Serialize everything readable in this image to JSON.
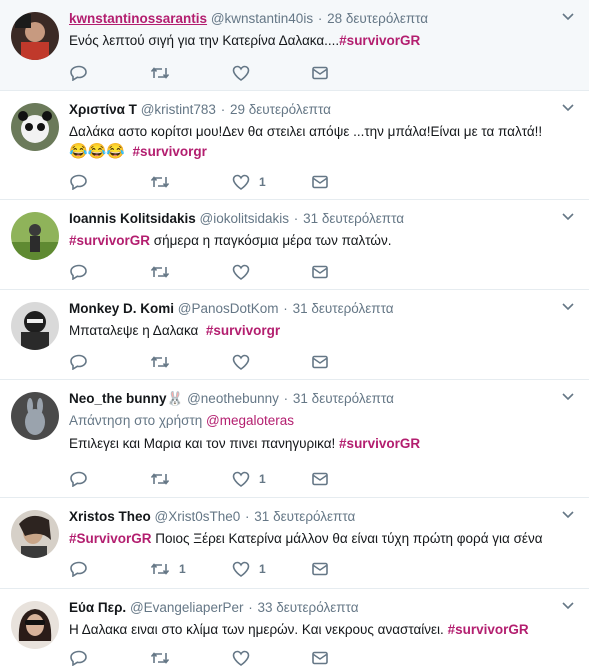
{
  "colors": {
    "accent": "#b31e6f",
    "muted": "#657786",
    "border": "#e6ecf0",
    "highlight_bg": "#f5f8fa"
  },
  "tweets": [
    {
      "name": "kwnstantinossarantis",
      "handle": "@kwnstantin40is",
      "time": "28 δευτερόλεπτα",
      "text": "Ενός λεπτού σιγή για την Κατερίνα Δαλακα....",
      "hashtag": "#survivorGR",
      "retweets": "",
      "likes": ""
    },
    {
      "name": "Χριστίνα Τ",
      "handle": "@kristint783",
      "time": "29 δευτερόλεπτα",
      "text": "Δαλάκα αστο κορίτσι μου!Δεν θα στειλει απόψε ...την μπάλα!Είναι με τα παλτά!!",
      "emoji": "😂😂😂",
      "hashtag": "#survivorgr",
      "retweets": "",
      "likes": "1"
    },
    {
      "name": "Ioannis Kolitsidakis",
      "handle": "@iokolitsidakis",
      "time": "31 δευτερόλεπτα",
      "hashtag": "#survivorGR",
      "text": " σήμερα η παγκόσμια μέρα των παλτών.",
      "retweets": "",
      "likes": ""
    },
    {
      "name": "Monkey D. Komi",
      "handle": "@PanosDotKom",
      "time": "31 δευτερόλεπτα",
      "text": "Μπαταλεψε η Δαλακα ",
      "hashtag": "#survivorgr",
      "retweets": "",
      "likes": ""
    },
    {
      "name": "Neo_the bunny",
      "name_emoji": "🐰",
      "handle": "@neothebunny",
      "time": "31 δευτερόλεπτα",
      "reply_prefix": "Απάντηση στο χρήστη ",
      "reply_mention": "@megaloteras",
      "text": "Επιλεγει και Μαρια και τον πινει πανηγυρικα! ",
      "hashtag": "#survivorGR",
      "retweets": "",
      "likes": "1"
    },
    {
      "name": "Xristos Theo",
      "handle": "@Xrist0sThe0",
      "time": "31 δευτερόλεπτα",
      "hashtag": "#SurvivorGR",
      "text": " Ποιος Ξέρει Κατερίνα μάλλον θα είναι τύχη πρώτη φορά για σένα",
      "retweets": "1",
      "likes": "1"
    },
    {
      "name": "Εύα Περ.",
      "handle": "@EvangeliaperPer",
      "time": "33 δευτερόλεπτα",
      "text": "Η Δαλακα ειναι στο κλίμα των ημερών. Και νεκρους ανασταίνει. ",
      "hashtag": "#survivorGR",
      "retweets": "",
      "likes": ""
    }
  ],
  "icons": {
    "reply": "reply-icon",
    "retweet": "retweet-icon",
    "like": "heart-icon",
    "dm": "envelope-icon",
    "more": "chevron-down-icon"
  }
}
